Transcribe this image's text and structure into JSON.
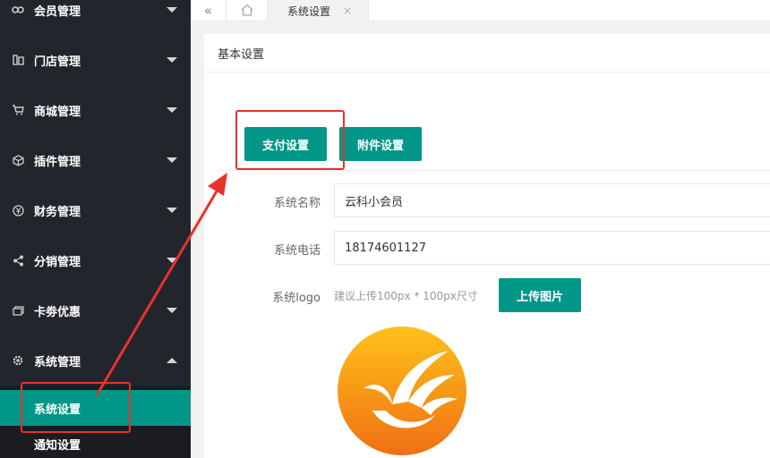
{
  "sidebar": {
    "items": [
      {
        "label": "会员管理",
        "icon": "link-icon"
      },
      {
        "label": "门店管理",
        "icon": "store-icon"
      },
      {
        "label": "商城管理",
        "icon": "cart-icon"
      },
      {
        "label": "插件管理",
        "icon": "cube-icon"
      },
      {
        "label": "财务管理",
        "icon": "yen-icon"
      },
      {
        "label": "分销管理",
        "icon": "share-icon"
      },
      {
        "label": "卡劵优惠",
        "icon": "coupon-icon"
      },
      {
        "label": "系统管理",
        "icon": "gear-icon"
      }
    ],
    "subitems": [
      {
        "label": "系统设置",
        "active": true
      },
      {
        "label": "通知设置",
        "active": false
      }
    ]
  },
  "tabs": {
    "active_title": "系统设置",
    "close_glyph": "×",
    "back_glyph": "«"
  },
  "panel": {
    "header": "基本设置",
    "buttons": {
      "pay": "支付设置",
      "attachment": "附件设置",
      "upload": "上传图片"
    },
    "form": {
      "name_label": "系统名称",
      "name_value": "云科小会员",
      "phone_label": "系统电话",
      "phone_value": "18174601127",
      "logo_label": "系统logo",
      "logo_hint": "建议上传100px * 100px尺寸"
    }
  },
  "colors": {
    "accent": "#009688",
    "sidebar_bg": "#22252c",
    "annotation": "#e8322b",
    "logo_orange": "#f39a1c"
  }
}
